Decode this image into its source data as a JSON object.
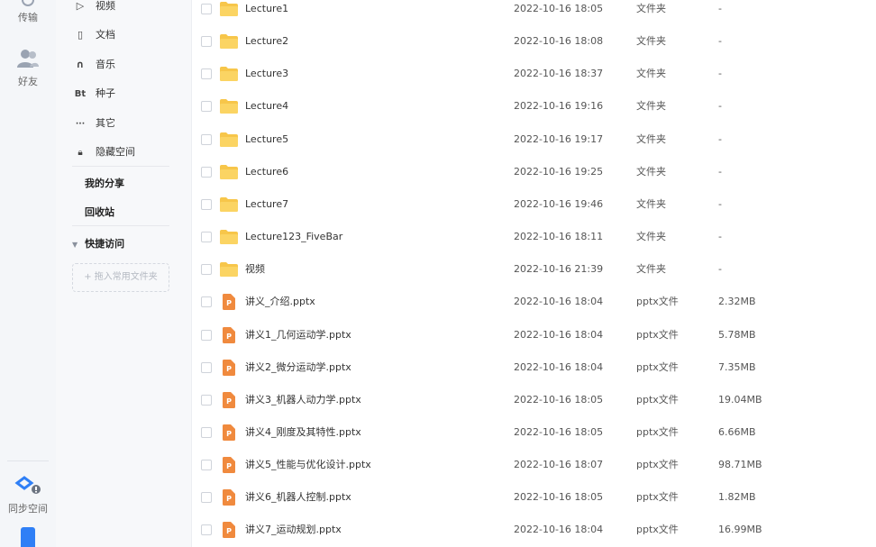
{
  "rail": {
    "transfer_label": "传输",
    "friends_label": "好友",
    "sync_label": "同步空间"
  },
  "sidebar": {
    "items": [
      {
        "icon": "play-icon",
        "glyph": "▷",
        "label": "视频"
      },
      {
        "icon": "document-icon",
        "glyph": "▯",
        "label": "文档"
      },
      {
        "icon": "headphones-icon",
        "glyph": "∩",
        "label": "音乐"
      },
      {
        "icon": "bt-icon",
        "glyph": "Bt",
        "label": "种子"
      },
      {
        "icon": "more-icon",
        "glyph": "···",
        "label": "其它"
      },
      {
        "icon": "lock-icon",
        "glyph": "🔒︎",
        "label": "隐藏空间"
      }
    ],
    "my_share": "我的分享",
    "recycle_bin": "回收站",
    "quick_access": "快捷访问",
    "drop_hint": "+ 拖入常用文件夹"
  },
  "files": [
    {
      "icon": "folder-icon",
      "name": "Lecture1",
      "date": "2022-10-16 18:05",
      "type": "文件夹",
      "size": "-"
    },
    {
      "icon": "folder-icon",
      "name": "Lecture2",
      "date": "2022-10-16 18:08",
      "type": "文件夹",
      "size": "-"
    },
    {
      "icon": "folder-icon",
      "name": "Lecture3",
      "date": "2022-10-16 18:37",
      "type": "文件夹",
      "size": "-"
    },
    {
      "icon": "folder-icon",
      "name": "Lecture4",
      "date": "2022-10-16 19:16",
      "type": "文件夹",
      "size": "-"
    },
    {
      "icon": "folder-icon",
      "name": "Lecture5",
      "date": "2022-10-16 19:17",
      "type": "文件夹",
      "size": "-"
    },
    {
      "icon": "folder-icon",
      "name": "Lecture6",
      "date": "2022-10-16 19:25",
      "type": "文件夹",
      "size": "-"
    },
    {
      "icon": "folder-icon",
      "name": "Lecture7",
      "date": "2022-10-16 19:46",
      "type": "文件夹",
      "size": "-"
    },
    {
      "icon": "folder-icon",
      "name": "Lecture123_FiveBar",
      "date": "2022-10-16 18:11",
      "type": "文件夹",
      "size": "-"
    },
    {
      "icon": "folder-icon",
      "name": "视频",
      "date": "2022-10-16 21:39",
      "type": "文件夹",
      "size": "-"
    },
    {
      "icon": "pptx-icon",
      "name": "讲义_介绍.pptx",
      "date": "2022-10-16 18:04",
      "type": "pptx文件",
      "size": "2.32MB"
    },
    {
      "icon": "pptx-icon",
      "name": "讲义1_几何运动学.pptx",
      "date": "2022-10-16 18:04",
      "type": "pptx文件",
      "size": "5.78MB"
    },
    {
      "icon": "pptx-icon",
      "name": "讲义2_微分运动学.pptx",
      "date": "2022-10-16 18:04",
      "type": "pptx文件",
      "size": "7.35MB"
    },
    {
      "icon": "pptx-icon",
      "name": "讲义3_机器人动力学.pptx",
      "date": "2022-10-16 18:05",
      "type": "pptx文件",
      "size": "19.04MB"
    },
    {
      "icon": "pptx-icon",
      "name": "讲义4_刚度及其特性.pptx",
      "date": "2022-10-16 18:05",
      "type": "pptx文件",
      "size": "6.66MB"
    },
    {
      "icon": "pptx-icon",
      "name": "讲义5_性能与优化设计.pptx",
      "date": "2022-10-16 18:07",
      "type": "pptx文件",
      "size": "98.71MB"
    },
    {
      "icon": "pptx-icon",
      "name": "讲义6_机器人控制.pptx",
      "date": "2022-10-16 18:05",
      "type": "pptx文件",
      "size": "1.82MB"
    },
    {
      "icon": "pptx-icon",
      "name": "讲义7_运动规划.pptx",
      "date": "2022-10-16 18:04",
      "type": "pptx文件",
      "size": "16.99MB"
    }
  ],
  "colors": {
    "folder": "#f7c64a",
    "pptx": "#f08a3e",
    "accent": "#2f7ff6"
  }
}
